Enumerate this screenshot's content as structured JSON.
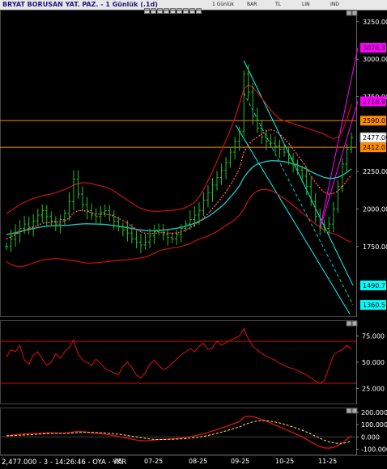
{
  "window": {
    "title": "BRYAT BORUSAN YAT. PAZ. - 1 Günlük (.1d)",
    "toolbar": [
      {
        "id": "tf",
        "label": "1 Günlük"
      },
      {
        "id": "bar",
        "label": "BAR"
      },
      {
        "id": "tl",
        "label": "TL"
      },
      {
        "id": "lin",
        "label": "LIN"
      },
      {
        "id": "ind",
        "label": "IND"
      }
    ]
  },
  "status": {
    "text": "2,477.000 - 3 - 14:26:46 - OYA - YKR"
  },
  "chart_data": [
    {
      "type": "line",
      "panel": "price",
      "y_ticks": [
        "3250.00",
        "3000.00",
        "2750.00",
        "2250.00",
        "2000.00",
        "1750.00"
      ],
      "ylim": [
        1280,
        3330
      ],
      "price_tags": [
        {
          "label": "3076.3",
          "value": 3076.3,
          "color": "#ff00ff"
        },
        {
          "label": "2718.9",
          "value": 2718.9,
          "color": "#ff00ff"
        },
        {
          "label": "2590.0",
          "value": 2590.0,
          "color": "#ff8c00"
        },
        {
          "label": "2477.00",
          "value": 2477.0,
          "color": "#ffffff"
        },
        {
          "label": "2412.0",
          "value": 2412.0,
          "color": "#ff8c00"
        },
        {
          "label": "1490.7",
          "value": 1490.7,
          "color": "#00ffff"
        },
        {
          "label": "1360.5",
          "value": 1360.5,
          "color": "#00ffff"
        }
      ],
      "horizontal_levels": [
        2590.0,
        2412.0
      ],
      "series": [
        {
          "kind": "close",
          "values": [
            1750,
            1800,
            1840,
            1870,
            1900,
            1880,
            1920,
            1960,
            1990,
            1950,
            1920,
            1900,
            1930,
            1970,
            2050,
            2200,
            2100,
            2030,
            1990,
            1960,
            1950,
            1980,
            1990,
            1960,
            1920,
            1880,
            1860,
            1840,
            1800,
            1780,
            1760,
            1780,
            1820,
            1850,
            1860,
            1830,
            1810,
            1800,
            1830,
            1870,
            1900,
            1930,
            1960,
            1990,
            2060,
            2110,
            2160,
            2210,
            2260,
            2310,
            2380,
            2450,
            2520,
            2900,
            2780,
            2620,
            2540,
            2480,
            2450,
            2440,
            2420,
            2400,
            2380,
            2340,
            2300,
            2260,
            2220,
            2150,
            2050,
            1950,
            1880,
            1870,
            1900,
            2000,
            2150,
            2300,
            2400,
            2477
          ]
        },
        {
          "kind": "ma_cyan",
          "values": [
            1830,
            1835,
            1842,
            1850,
            1858,
            1864,
            1870,
            1876,
            1882,
            1886,
            1888,
            1889,
            1890,
            1891,
            1893,
            1896,
            1899,
            1901,
            1902,
            1901,
            1900,
            1899,
            1897,
            1894,
            1890,
            1886,
            1881,
            1876,
            1870,
            1865,
            1860,
            1857,
            1855,
            1855,
            1857,
            1860,
            1863,
            1867,
            1872,
            1878,
            1886,
            1895,
            1906,
            1918,
            1933,
            1950,
            1970,
            1993,
            2018,
            2046,
            2080,
            2115,
            2155,
            2210,
            2250,
            2280,
            2300,
            2310,
            2318,
            2322,
            2322,
            2320,
            2316,
            2310,
            2302,
            2292,
            2280,
            2265,
            2250,
            2235,
            2222,
            2210,
            2205,
            2205,
            2212,
            2225,
            2245,
            2268
          ]
        },
        {
          "kind": "ma_red_dotted",
          "values": [
            1800,
            1815,
            1830,
            1845,
            1860,
            1870,
            1880,
            1892,
            1905,
            1910,
            1912,
            1913,
            1916,
            1922,
            1940,
            1975,
            1990,
            1990,
            1985,
            1975,
            1968,
            1966,
            1966,
            1962,
            1952,
            1938,
            1922,
            1905,
            1885,
            1866,
            1848,
            1838,
            1835,
            1838,
            1842,
            1843,
            1840,
            1838,
            1840,
            1848,
            1860,
            1876,
            1895,
            1915,
            1940,
            1970,
            2002,
            2038,
            2075,
            2115,
            2160,
            2212,
            2268,
            2380,
            2430,
            2460,
            2480,
            2500,
            2520,
            2530,
            2520,
            2500,
            2470,
            2440,
            2400,
            2360,
            2320,
            2270,
            2220,
            2175,
            2140,
            2110,
            2100,
            2105,
            2120,
            2150,
            2190,
            2230
          ]
        },
        {
          "kind": "bb_upper",
          "values": [
            1970,
            1990,
            2010,
            2030,
            2045,
            2060,
            2070,
            2080,
            2090,
            2095,
            2100,
            2110,
            2120,
            2130,
            2145,
            2160,
            2170,
            2175,
            2175,
            2170,
            2162,
            2155,
            2148,
            2135,
            2120,
            2100,
            2080,
            2060,
            2040,
            2020,
            2005,
            1995,
            1988,
            1985,
            1985,
            1988,
            1990,
            1992,
            1995,
            2000,
            2010,
            2025,
            2045,
            2080,
            2130,
            2190,
            2250,
            2320,
            2390,
            2460,
            2530,
            2610,
            2700,
            2800,
            2830,
            2810,
            2780,
            2740,
            2700,
            2660,
            2630,
            2600,
            2590,
            2580,
            2570,
            2560,
            2550,
            2540,
            2530,
            2520,
            2510,
            2500,
            2480,
            2470,
            2480,
            2520,
            2600,
            2700
          ]
        },
        {
          "kind": "bb_lower",
          "values": [
            1650,
            1630,
            1620,
            1615,
            1620,
            1630,
            1640,
            1650,
            1660,
            1665,
            1668,
            1670,
            1668,
            1665,
            1660,
            1655,
            1650,
            1645,
            1640,
            1640,
            1642,
            1645,
            1648,
            1652,
            1655,
            1658,
            1660,
            1662,
            1665,
            1670,
            1675,
            1680,
            1690,
            1705,
            1720,
            1730,
            1735,
            1740,
            1745,
            1750,
            1760,
            1770,
            1785,
            1800,
            1810,
            1820,
            1835,
            1850,
            1870,
            1890,
            1910,
            1930,
            1960,
            2000,
            2060,
            2100,
            2120,
            2130,
            2130,
            2125,
            2110,
            2090,
            2070,
            2050,
            2025,
            2000,
            1975,
            1950,
            1925,
            1900,
            1880,
            1860,
            1845,
            1835,
            1825,
            1810,
            1790,
            1780
          ]
        }
      ]
    },
    {
      "type": "line",
      "panel": "rsi",
      "y_ticks": [
        "75.000",
        "50.000",
        "25.000"
      ],
      "ylim": [
        10,
        90
      ],
      "levels": [
        70,
        30
      ],
      "series": [
        {
          "kind": "rsi",
          "values": [
            55,
            62,
            60,
            66,
            52,
            48,
            57,
            60,
            53,
            47,
            50,
            58,
            54,
            60,
            64,
            71,
            58,
            52,
            50,
            47,
            53,
            49,
            44,
            42,
            40,
            38,
            46,
            50,
            45,
            38,
            35,
            40,
            48,
            52,
            47,
            43,
            45,
            49,
            53,
            57,
            60,
            63,
            60,
            65,
            68,
            62,
            64,
            70,
            66,
            69,
            71,
            73,
            75,
            82,
            72,
            65,
            62,
            58,
            56,
            54,
            52,
            49,
            47,
            45,
            44,
            42,
            40,
            38,
            35,
            32,
            30,
            33,
            45,
            57,
            60,
            62,
            66,
            62
          ]
        }
      ]
    },
    {
      "type": "line",
      "panel": "macd",
      "y_ticks": [
        "200.000",
        "100.000",
        "0.000",
        "-100.000"
      ],
      "ylim": [
        -150,
        240
      ],
      "series": [
        {
          "kind": "macd",
          "values": [
            10,
            14,
            18,
            22,
            24,
            26,
            27,
            29,
            32,
            34,
            33,
            31,
            29,
            30,
            34,
            42,
            45,
            43,
            39,
            34,
            30,
            26,
            22,
            17,
            11,
            4,
            -3,
            -10,
            -18,
            -25,
            -30,
            -32,
            -30,
            -26,
            -22,
            -20,
            -18,
            -16,
            -13,
            -9,
            -4,
            2,
            9,
            17,
            26,
            36,
            48,
            60,
            72,
            84,
            98,
            112,
            126,
            160,
            170,
            165,
            155,
            142,
            128,
            114,
            98,
            82,
            66,
            50,
            34,
            18,
            0,
            -20,
            -42,
            -62,
            -80,
            -90,
            -92,
            -85,
            -70,
            -48,
            -20,
            10
          ]
        },
        {
          "kind": "signal",
          "values": [
            8,
            10,
            12,
            14,
            16,
            18,
            20,
            22,
            24,
            26,
            28,
            29,
            29,
            29,
            30,
            32,
            35,
            37,
            38,
            37,
            36,
            34,
            32,
            29,
            26,
            22,
            17,
            12,
            6,
            0,
            -6,
            -12,
            -17,
            -20,
            -21,
            -21,
            -20,
            -19,
            -18,
            -16,
            -13,
            -10,
            -6,
            -1,
            5,
            12,
            20,
            29,
            39,
            49,
            60,
            71,
            82,
            98,
            112,
            123,
            130,
            133,
            132,
            128,
            122,
            114,
            104,
            93,
            81,
            68,
            55,
            40,
            23,
            6,
            -11,
            -27,
            -40,
            -49,
            -53,
            -52,
            -46,
            -34
          ]
        }
      ]
    }
  ],
  "x_axis": {
    "labels": [
      "-25",
      "07-25",
      "08-25",
      "09-25",
      "10-25",
      "11-25"
    ]
  }
}
